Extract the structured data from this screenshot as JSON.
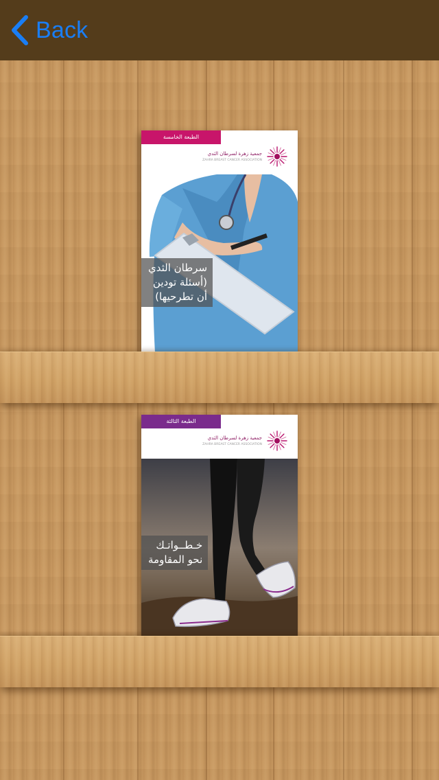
{
  "nav": {
    "back_label": "Back",
    "accent_color": "#1a7ef5",
    "bar_color": "#543c1b"
  },
  "books": [
    {
      "edition": "الطبعة الخامسة",
      "edition_color": "#c8156a",
      "org_name": "جمعية زهرة لسرطان الثدي",
      "org_name_en": "ZAHRA BREAST CANCER ASSOCIATION",
      "title_line1": "سرطان الثدي",
      "title_line2": "(أسئلة تودين",
      "title_line3": "أن تطرحيها)",
      "cover_image": "nurse-with-clipboard"
    },
    {
      "edition": "الطبعة الثالثة",
      "edition_color": "#7a2b8c",
      "org_name": "جمعية زهرة لسرطان الثدي",
      "org_name_en": "ZAHRA BREAST CANCER ASSOCIATION",
      "title_line1": "خـطــواتـك",
      "title_line2": "نحو المقاومة",
      "cover_image": "running-shoes"
    }
  ]
}
